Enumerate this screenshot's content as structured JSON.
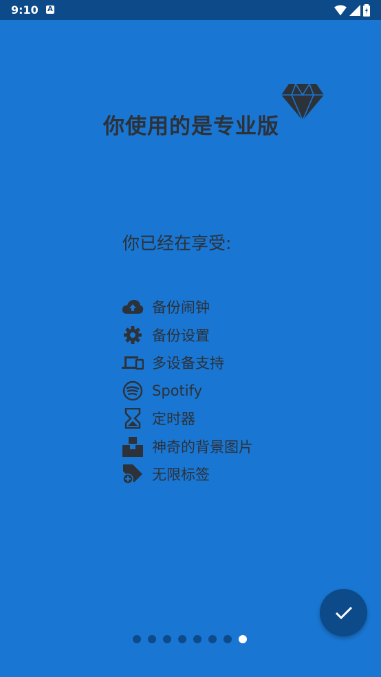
{
  "status_bar": {
    "time": "9:10",
    "badge": "A"
  },
  "header": {
    "title": "你使用的是专业版"
  },
  "subtitle": "你已经在享受:",
  "features": [
    {
      "label": "备份闹钟",
      "icon": "cloud-upload-icon"
    },
    {
      "label": "备份设置",
      "icon": "gear-icon"
    },
    {
      "label": "多设备支持",
      "icon": "devices-icon"
    },
    {
      "label": "Spotify",
      "icon": "spotify-icon"
    },
    {
      "label": "定时器",
      "icon": "hourglass-icon"
    },
    {
      "label": "神奇的背景图片",
      "icon": "image-stack-icon"
    },
    {
      "label": "无限标签",
      "icon": "tag-plus-icon"
    }
  ],
  "pagination": {
    "total": 8,
    "active_index": 7
  },
  "colors": {
    "background": "#1976d2",
    "statusbar": "#0d4a8a",
    "text": "#2d3138",
    "fab": "#0d4a8a",
    "dot_inactive": "#0d4a8a",
    "dot_active": "#ffffff"
  }
}
